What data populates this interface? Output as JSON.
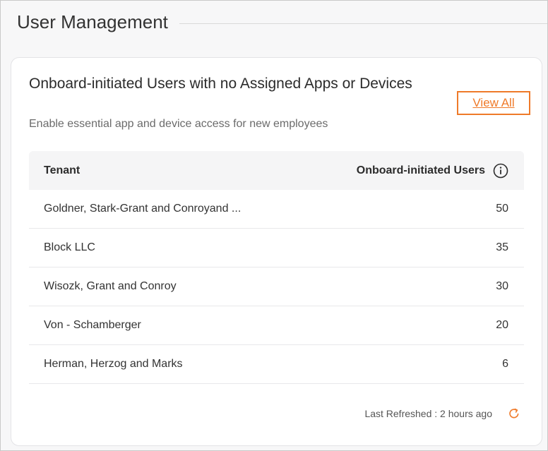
{
  "page": {
    "title": "User Management"
  },
  "card": {
    "title": "Onboard-initiated Users with no Assigned Apps or Devices",
    "subtitle": "Enable essential app and device access for new employees",
    "view_all_label": "View All"
  },
  "table": {
    "columns": [
      "Tenant",
      "Onboard-initiated Users"
    ],
    "rows": [
      {
        "tenant": "Goldner, Stark-Grant and Conroyand ...",
        "users": "50"
      },
      {
        "tenant": "Block LLC",
        "users": "35"
      },
      {
        "tenant": "Wisozk, Grant and Conroy",
        "users": "30"
      },
      {
        "tenant": "Von - Schamberger",
        "users": "20"
      },
      {
        "tenant": "Herman, Herzog and Marks",
        "users": "6"
      }
    ]
  },
  "footer": {
    "last_refreshed": "Last Refreshed : 2 hours ago"
  },
  "icons": {
    "info": "info-icon",
    "refresh": "refresh-icon"
  },
  "colors": {
    "accent": "#ef7a29"
  }
}
